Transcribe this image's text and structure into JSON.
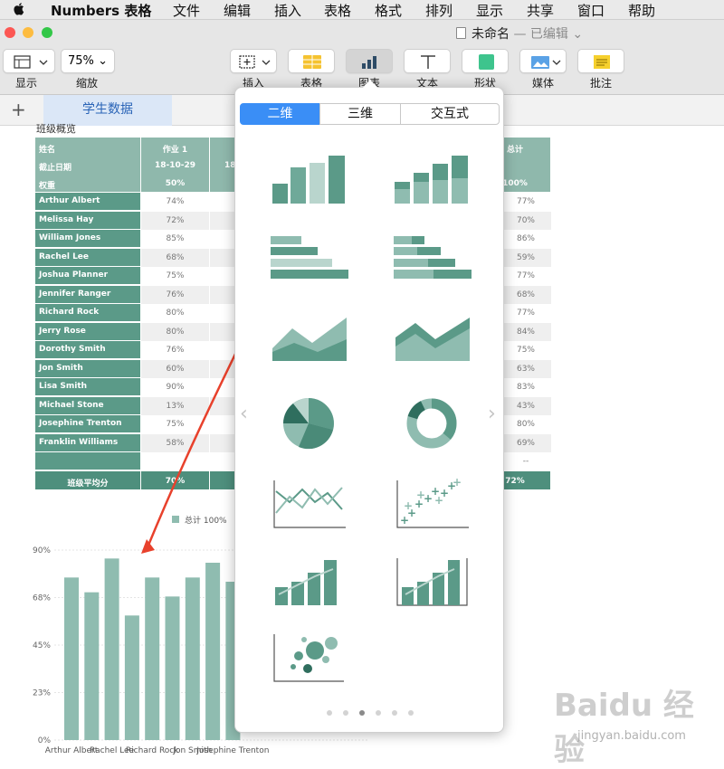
{
  "menubar": {
    "apple": "",
    "app": "Numbers 表格",
    "items": [
      "文件",
      "编辑",
      "插入",
      "表格",
      "格式",
      "排列",
      "显示",
      "共享",
      "窗口",
      "帮助"
    ]
  },
  "window": {
    "doc_title": "未命名",
    "doc_status": "— 已编辑",
    "traffic_colors": [
      "#fc5753",
      "#fdbc40",
      "#33c748"
    ]
  },
  "toolbar": {
    "view_label": "显示",
    "zoom_value": "75%",
    "zoom_label": "缩放",
    "insert_label": "插入",
    "table_label": "表格",
    "chart_label": "图表",
    "text_label": "文本",
    "shape_label": "形状",
    "media_label": "媒体",
    "comment_label": "批注"
  },
  "tabbar": {
    "add": "+",
    "tab": "学生数据"
  },
  "sheet": {
    "title": "班级概览",
    "header": {
      "name": "姓名",
      "due": "截止日期",
      "weight": "权重",
      "col1": "作业 1",
      "col1_date": "18-10-29",
      "col1_weight": "50%",
      "col2_date_partial": "18",
      "total": "总计",
      "total_weight": "100%"
    },
    "rows": [
      {
        "name": "Arthur Albert",
        "a1": "74%",
        "total": "77%"
      },
      {
        "name": "Melissa Hay",
        "a1": "72%",
        "total": "70%"
      },
      {
        "name": "William Jones",
        "a1": "85%",
        "total": "86%"
      },
      {
        "name": "Rachel Lee",
        "a1": "68%",
        "total": "59%"
      },
      {
        "name": "Joshua Planner",
        "a1": "75%",
        "total": "77%"
      },
      {
        "name": "Jennifer Ranger",
        "a1": "76%",
        "total": "68%"
      },
      {
        "name": "Richard Rock",
        "a1": "80%",
        "total": "77%"
      },
      {
        "name": "Jerry Rose",
        "a1": "80%",
        "total": "84%"
      },
      {
        "name": "Dorothy Smith",
        "a1": "76%",
        "total": "75%"
      },
      {
        "name": "Jon Smith",
        "a1": "60%",
        "total": "63%"
      },
      {
        "name": "Lisa Smith",
        "a1": "90%",
        "total": "83%"
      },
      {
        "name": "Michael Stone",
        "a1": "13%",
        "total": "43%"
      },
      {
        "name": "Josephine Trenton",
        "a1": "75%",
        "total": "80%"
      },
      {
        "name": "Franklin Williams",
        "a1": "58%",
        "total": "69%"
      },
      {
        "name": "",
        "a1": "",
        "total": "--"
      }
    ],
    "footer": {
      "label": "班级平均分",
      "a1": "70%",
      "total": "72%"
    }
  },
  "popover": {
    "segments": [
      "二维",
      "三维",
      "交互式"
    ],
    "selected_segment": 0,
    "page_count": 6,
    "active_page": 2
  },
  "chart_data": {
    "type": "bar",
    "legend": [
      "总计 100%"
    ],
    "categories": [
      "Arthur Albert",
      "Melissa Hay",
      "William Jones",
      "Rachel Lee",
      "Joshua Planner",
      "Jennifer Ranger",
      "Richard Rock",
      "Jerry Rose",
      "Dorothy Smith"
    ],
    "x_tick_labels": [
      "Arthur Albert",
      "Rachel Lee",
      "Richard Rock",
      "Jon Smith",
      "Josephine Trenton"
    ],
    "values": [
      77,
      70,
      86,
      59,
      77,
      68,
      77,
      84,
      75
    ],
    "y_ticks": [
      "90%",
      "68%",
      "45%",
      "23%",
      "0%"
    ],
    "ylim": [
      0,
      90
    ],
    "grid": true,
    "bar_color": "#8fbcb0"
  },
  "watermark": {
    "brand": "Baidu 经验",
    "url": "jingyan.baidu.com"
  },
  "colors": {
    "accent": "#3a8ef6",
    "table_header": "#8fb8ac",
    "name_col": "#5b9a88",
    "footer": "#4e8f7d",
    "arrow": "#e8412c"
  }
}
